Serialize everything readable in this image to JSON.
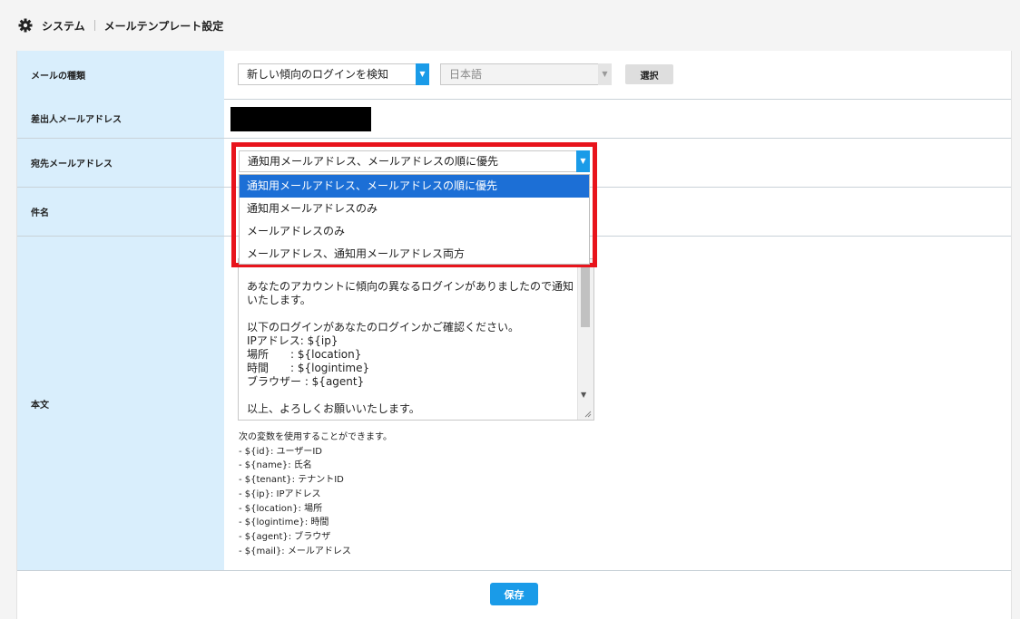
{
  "breadcrumb": {
    "root": "システム",
    "current": "メールテンプレート設定"
  },
  "form": {
    "mail_type": {
      "label": "メールの種類",
      "selected": "新しい傾向のログインを検知",
      "language": "日本語",
      "select_button": "選択"
    },
    "sender": {
      "label": "差出人メールアドレス"
    },
    "recipient": {
      "label": "宛先メールアドレス",
      "selected": "通知用メールアドレス、メールアドレスの順に優先",
      "options": [
        "通知用メールアドレス、メールアドレスの順に優先",
        "通知用メールアドレスのみ",
        "メールアドレスのみ",
        "メールアドレス、通知用メールアドレス両方"
      ]
    },
    "subject": {
      "label": "件名"
    },
    "body": {
      "label": "本文",
      "text": "あなたのアカウントに傾向の異なるログインがありましたので通知いたします。\n\n以下のログインがあなたのログインかご確認ください。\nIPアドレス: ${ip}\n場所　　: ${location}\n時間　　: ${logintime}\nブラウザー : ${agent}\n\n以上、よろしくお願いいたします。",
      "vars_intro": "次の変数を使用することができます。",
      "vars": [
        "- ${id}: ユーザーID",
        "- ${name}: 氏名",
        "- ${tenant}: テナントID",
        "- ${ip}: IPアドレス",
        "- ${location}: 場所",
        "- ${logintime}: 時間",
        "- ${agent}: ブラウザ",
        "- ${mail}: メールアドレス"
      ]
    }
  },
  "save_button": "保存",
  "icons": {
    "settings": "gear-icon",
    "dropdown": "chevron-down-icon"
  },
  "colors": {
    "accent": "#1a9be8",
    "label_bg": "#d9eefc",
    "highlight": "#e8141c",
    "option_selected": "#1c6fd6"
  }
}
